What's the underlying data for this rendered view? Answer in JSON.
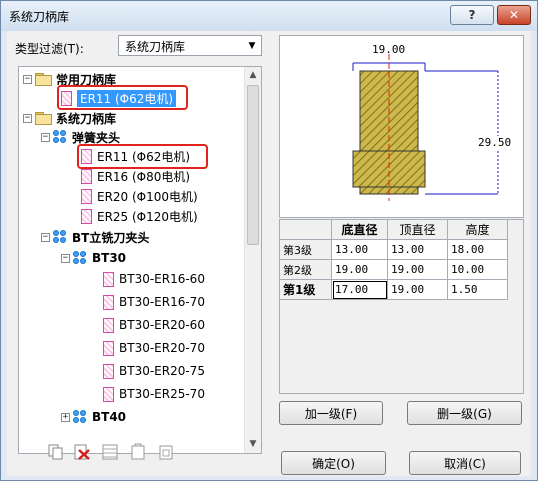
{
  "window": {
    "title": "系统刀柄库",
    "help_label": "?",
    "close_label": "✕"
  },
  "filter": {
    "label": "类型过滤(T):",
    "value": "系统刀柄库"
  },
  "tree": [
    {
      "label": "常用刀柄库",
      "bold": true
    },
    {
      "label": "ER11 (Φ62电机)",
      "selected": true
    },
    {
      "label": "系统刀柄库",
      "bold": true
    },
    {
      "label": "弹簧夹头",
      "bold": true
    },
    {
      "label": "ER11 (Φ62电机)"
    },
    {
      "label": "ER16 (Φ80电机)"
    },
    {
      "label": "ER20 (Φ100电机)"
    },
    {
      "label": "ER25 (Φ120电机)"
    },
    {
      "label": "BT立铣刀夹头",
      "bold": true
    },
    {
      "label": "BT30",
      "bold": true
    },
    {
      "label": "BT30-ER16-60"
    },
    {
      "label": "BT30-ER16-70"
    },
    {
      "label": "BT30-ER20-60"
    },
    {
      "label": "BT30-ER20-70"
    },
    {
      "label": "BT30-ER20-75"
    },
    {
      "label": "BT30-ER25-70"
    },
    {
      "label": "BT40",
      "bold": true
    }
  ],
  "preview": {
    "width_dim": "19.00",
    "height_dim": "29.50"
  },
  "levels": {
    "headers": [
      "底直径",
      "顶直径",
      "高度"
    ],
    "rows": [
      {
        "label": "第3级",
        "values": [
          "13.00",
          "13.00",
          "18.00"
        ]
      },
      {
        "label": "第2级",
        "values": [
          "19.00",
          "19.00",
          "10.00"
        ]
      },
      {
        "label": "第1级",
        "values": [
          "17.00",
          "19.00",
          "1.50"
        ]
      }
    ]
  },
  "buttons": {
    "add": "加一级(F)",
    "delete": "删一级(G)",
    "ok": "确定(O)",
    "cancel": "取消(C)"
  },
  "colors": {
    "selection": "#3399ff",
    "highlight": "#e0231c",
    "hatch": "#b9a23a"
  }
}
